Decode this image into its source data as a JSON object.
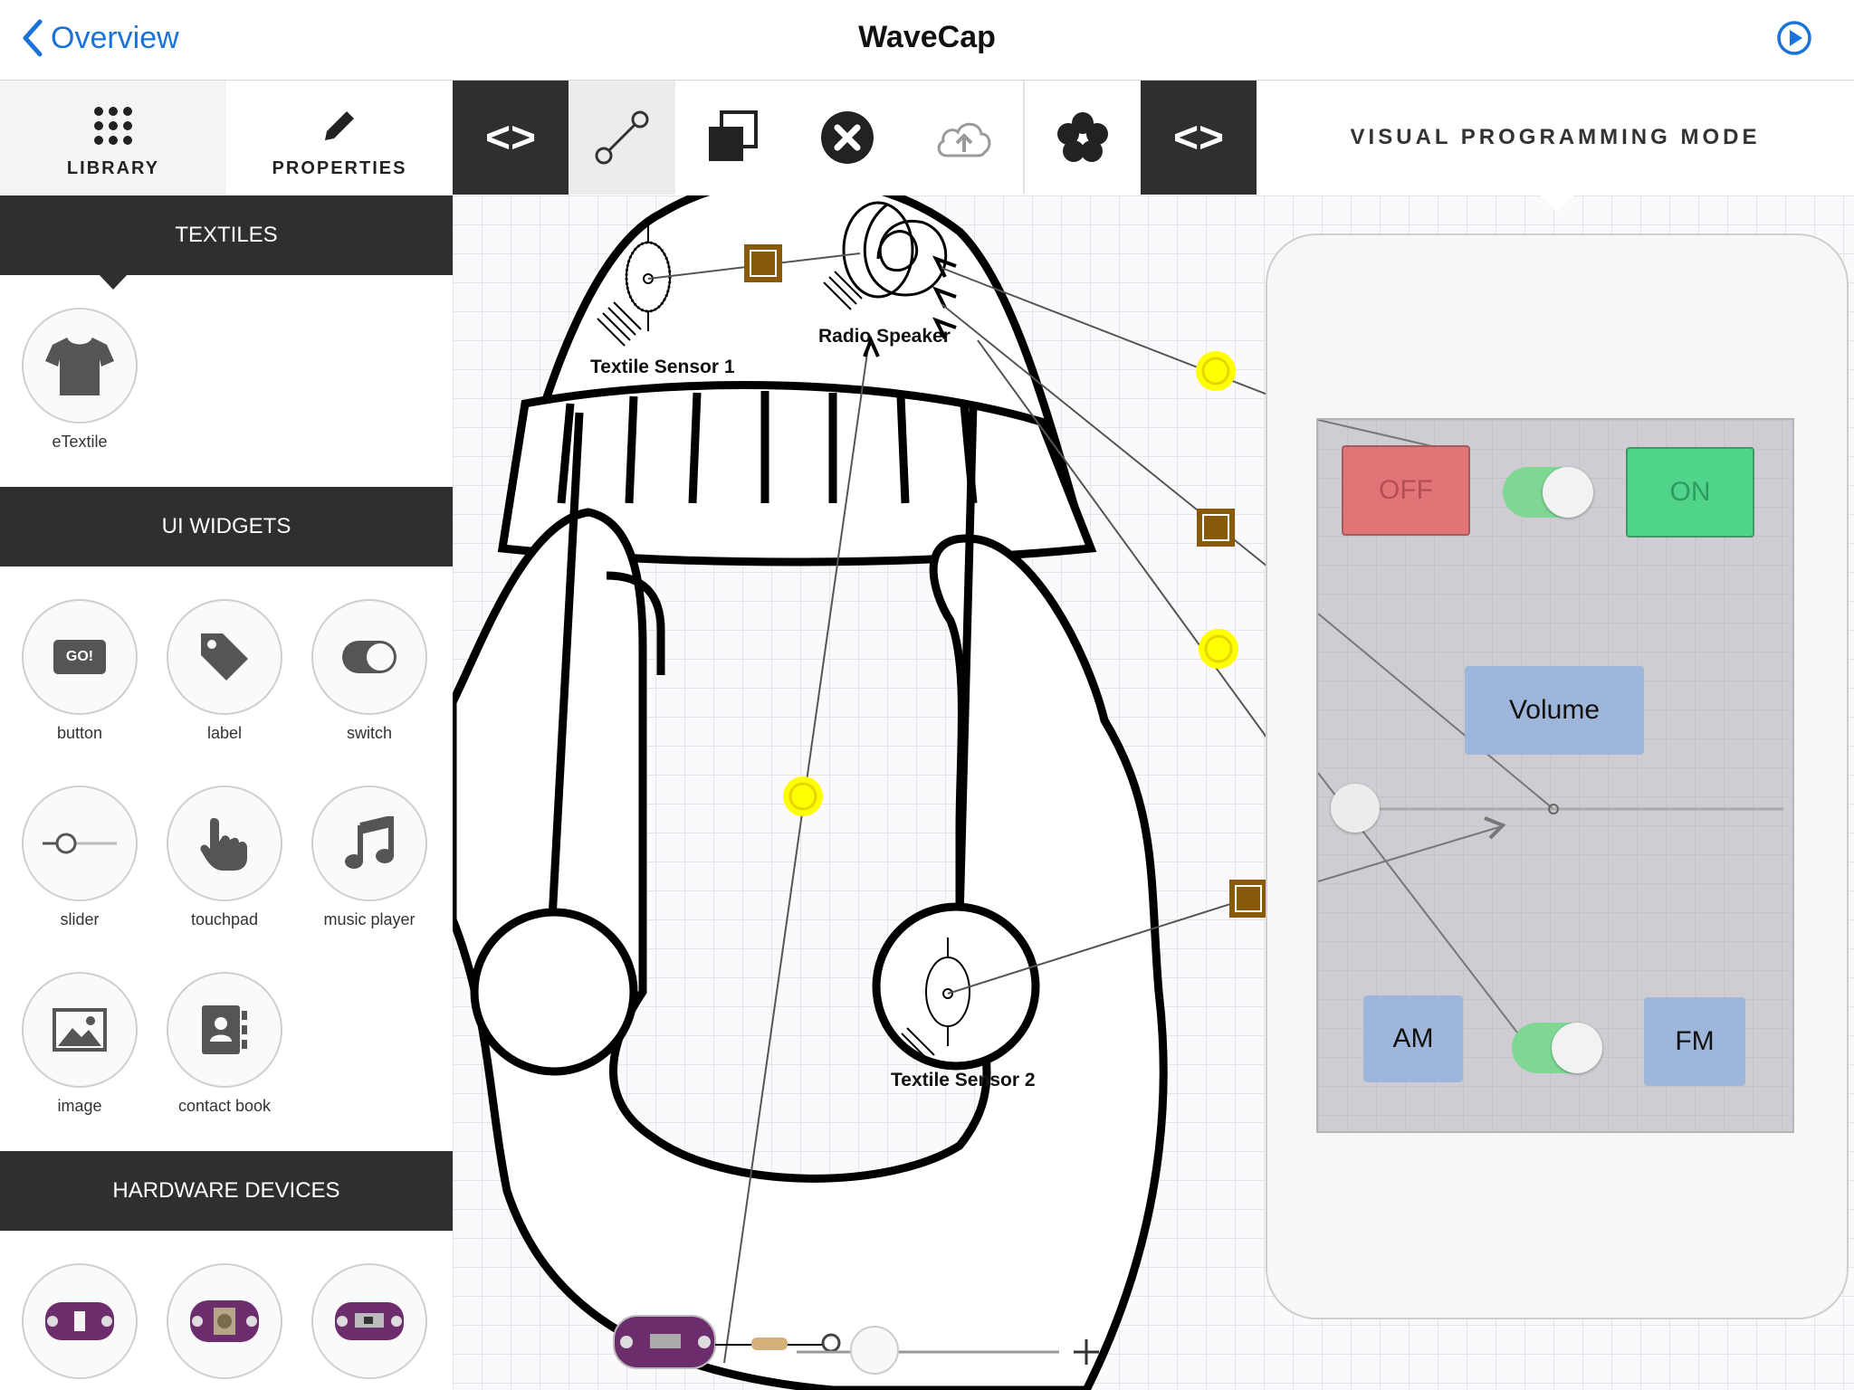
{
  "nav": {
    "back_label": "Overview",
    "title": "WaveCap"
  },
  "toolbar": {
    "library_tab": "LIBRARY",
    "properties_tab": "PROPERTIES",
    "mode_label": "VISUAL PROGRAMMING MODE",
    "code_left": "<>",
    "code_right": "<>"
  },
  "sidebar": {
    "textiles": {
      "header": "TEXTILES",
      "items": [
        {
          "label": "eTextile",
          "icon": "tshirt-icon"
        }
      ]
    },
    "ui_widgets": {
      "header": "UI WIDGETS",
      "items": [
        {
          "label": "button",
          "icon": "go-button-icon",
          "icon_text": "GO!"
        },
        {
          "label": "label",
          "icon": "tag-icon"
        },
        {
          "label": "switch",
          "icon": "toggle-icon"
        },
        {
          "label": "slider",
          "icon": "slider-icon"
        },
        {
          "label": "touchpad",
          "icon": "hand-pointer-icon"
        },
        {
          "label": "music player",
          "icon": "music-note-icon"
        },
        {
          "label": "image",
          "icon": "picture-icon"
        },
        {
          "label": "contact book",
          "icon": "contact-book-icon"
        }
      ]
    },
    "hardware": {
      "header": "HARDWARE DEVICES"
    }
  },
  "canvas": {
    "labels": {
      "sensor1": "Textile Sensor 1",
      "speaker": "Radio Speaker",
      "sensor2": "Textile Sensor 2"
    }
  },
  "phone": {
    "off_label": "OFF",
    "on_label": "ON",
    "volume_label": "Volume",
    "am_label": "AM",
    "fm_label": "FM",
    "slider_value": 0
  },
  "colors": {
    "accent": "#1a73d9",
    "dark": "#2f2f2d",
    "off_button": "#e27478",
    "on_button": "#4fd489",
    "widget_blue": "#9eb6d9",
    "node_yellow": "#ffff00",
    "node_brown": "#8a5a0b"
  }
}
